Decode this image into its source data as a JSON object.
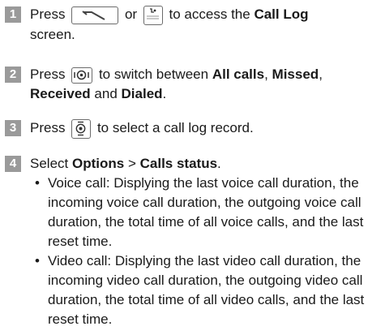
{
  "steps": [
    {
      "number": "1",
      "pre": "Press",
      "or": "or",
      "after": "to access the",
      "bold": "Call Log",
      "tail": "screen."
    },
    {
      "number": "2",
      "pre": "Press",
      "after": "to switch between",
      "opt1": "All calls",
      "sep1": ",",
      "opt2": "Missed",
      "sep2": ",",
      "opt3": "Received",
      "and": "and",
      "opt4": "Dialed",
      "end": "."
    },
    {
      "number": "3",
      "pre": "Press",
      "after": "to select a call log record."
    },
    {
      "number": "4",
      "pre": "Select",
      "menu1": "Options",
      "arrow": ">",
      "menu2": "Calls status",
      "end": ".",
      "bullets": [
        "Voice call: Displying the last voice call duration, the incoming voice call duration, the outgoing voice call duration, the total time of all voice calls, and the last reset time.",
        "Video call: Displying the last video call duration, the incoming video call duration, the outgoing video call duration, the total time of all video calls, and the last reset time."
      ]
    }
  ],
  "icons": {
    "send_key": "phone-send-key-icon",
    "log_key": "call-log-key-icon",
    "nav_key": "navigation-key-icon",
    "ok_key": "center-ok-key-icon"
  },
  "colors": {
    "badge": "#9a9a9a",
    "text": "#1a1a1a"
  }
}
